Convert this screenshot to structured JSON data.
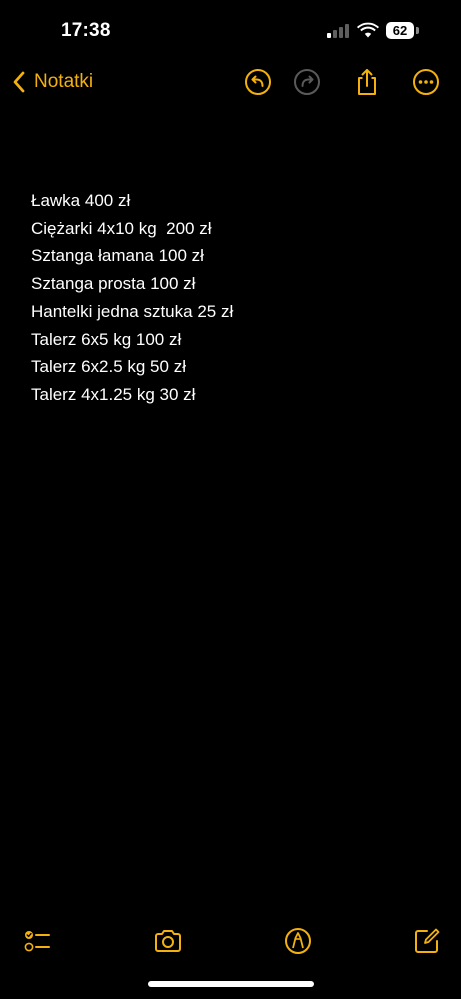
{
  "status_bar": {
    "time": "17:38",
    "battery_level": "62"
  },
  "nav": {
    "back_label": "Notatki",
    "back_icon": "chevron-left-icon",
    "buttons": [
      "undo-icon",
      "redo-icon",
      "share-icon",
      "more-icon"
    ]
  },
  "note": {
    "lines": [
      "Ławka 400 zł",
      "Ciężarki 4x10 kg  200 zł",
      "Sztanga łamana 100 zł",
      "Sztanga prosta 100 zł",
      "Hantelki jedna sztuka 25 zł",
      "Talerz 6x5 kg 100 zł",
      "Talerz 6x2.5 kg 50 zł",
      "Talerz 4x1.25 kg 30 zł"
    ]
  },
  "toolbar": {
    "buttons": [
      "checklist-icon",
      "camera-icon",
      "markup-pen-icon",
      "compose-icon"
    ]
  },
  "colors": {
    "accent": "#f2b10e",
    "background": "#000000",
    "text": "#ffffff",
    "disabled": "#5a5a5a"
  }
}
